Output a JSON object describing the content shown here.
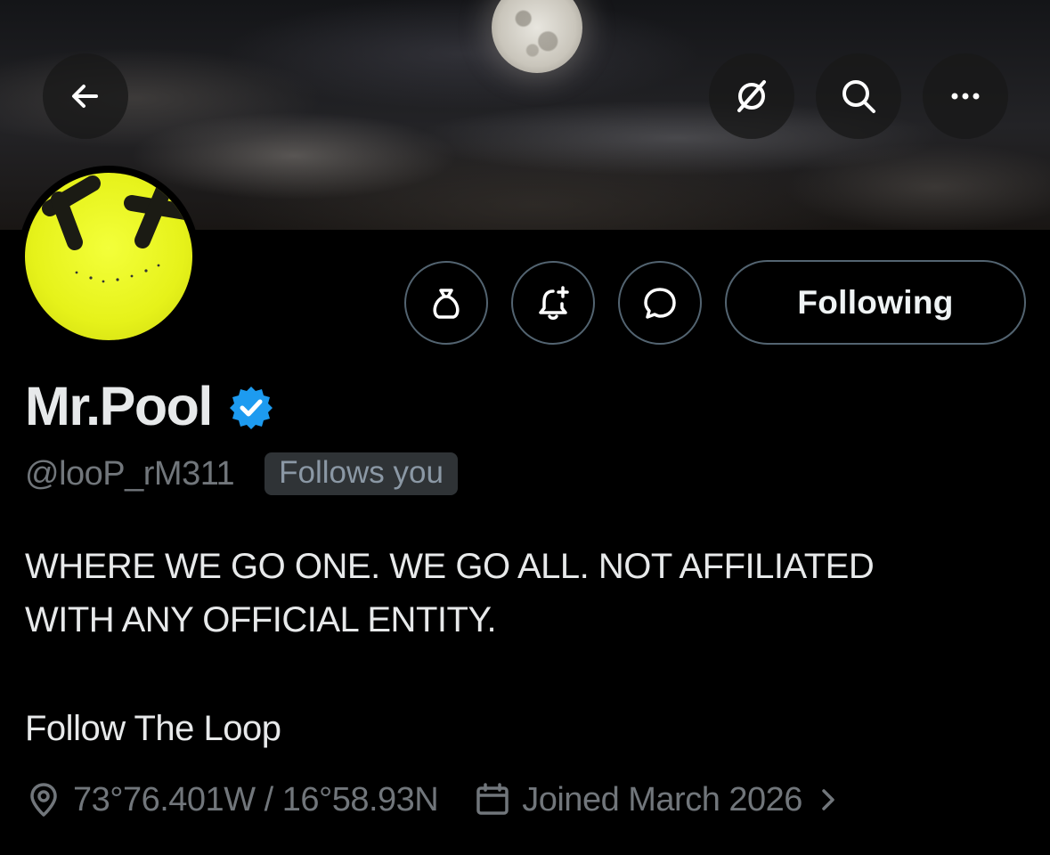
{
  "header": {
    "back_icon": "arrow-left-icon",
    "grok_icon": "grok-icon",
    "search_icon": "search-icon",
    "more_icon": "more-icon"
  },
  "profile": {
    "display_name": "Mr.Pool",
    "handle": "@looP_rM311",
    "follows_you_badge": "Follows you",
    "bio_lines": [
      "WHERE WE GO ONE. WE GO ALL. NOT AFFILIATED",
      "WITH ANY OFFICIAL ENTITY."
    ],
    "bio_extra": "Follow The Loop",
    "location": "73°76.401W / 16°58.93N",
    "joined": "Joined March 2026"
  },
  "actions": {
    "following_label": "Following",
    "grok_profile_icon": "bag-icon",
    "notify_icon": "bell-plus-icon",
    "message_icon": "message-bubble-icon"
  },
  "colors": {
    "background": "#000000",
    "verified_badge": "#1d9bf0",
    "muted_text": "#71767b",
    "avatar_yellow": "#e6f21a"
  }
}
